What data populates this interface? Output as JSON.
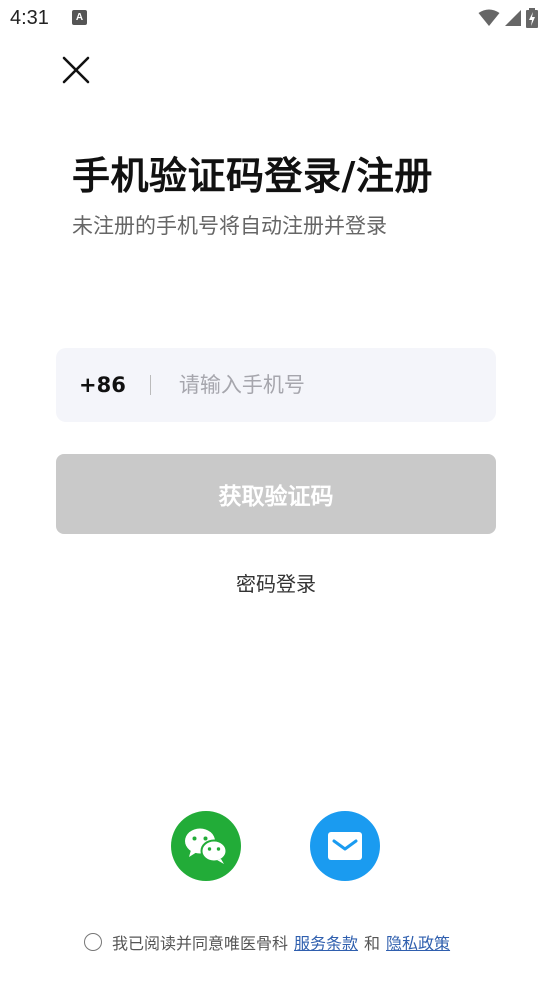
{
  "status_bar": {
    "time": "4:31",
    "app_icon_letter": "A"
  },
  "header": {
    "title": "手机验证码登录/注册",
    "subtitle": "未注册的手机号将自动注册并登录"
  },
  "phone_form": {
    "country_code": "+86",
    "placeholder": "请输入手机号",
    "value": ""
  },
  "buttons": {
    "get_code": "获取验证码",
    "password_login": "密码登录"
  },
  "social": {
    "wechat_icon": "wechat-icon",
    "email_icon": "email-icon",
    "wechat_color": "#22ac38",
    "email_color": "#1a9bf0"
  },
  "agreement": {
    "prefix": "我已阅读并同意唯医骨科",
    "terms_link": "服务条款",
    "conjunction": "和",
    "privacy_link": "隐私政策",
    "checked": false
  },
  "colors": {
    "disabled_button": "#c9c9c9",
    "input_bg": "#f4f5fa",
    "link": "#2f5fae"
  }
}
